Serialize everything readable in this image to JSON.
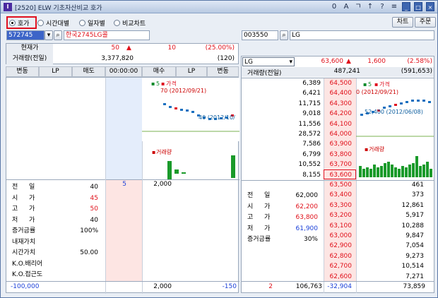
{
  "window": {
    "title": "[2520] ELW 기초자산비교 호가",
    "icon": "I",
    "buttons": [
      "0",
      "A",
      "ㄱ",
      "↑",
      "?",
      "≡",
      "_",
      "□",
      "×"
    ]
  },
  "tabs": {
    "hoga": "호가",
    "time": "시간대별",
    "daily": "일자별",
    "compare": "비교차트",
    "selected": "호가"
  },
  "toolbar": {
    "chart_btn": "차트",
    "order_btn": "주문"
  },
  "left": {
    "code": "572745",
    "name": "한국2745LG콜",
    "cur_price_label": "현재가",
    "cur_price": "50",
    "change_arrow": "▲",
    "change": "10",
    "change_pct": "(25.00%)",
    "vol_label": "거래량(전일)",
    "vol": "3,377,820",
    "vol_prev": "(120)",
    "headers": [
      "변동",
      "LP",
      "매도",
      "00:00:00",
      "매수",
      "LP",
      "변동"
    ],
    "buy_qty": "2,000",
    "buy_count": "5",
    "info": [
      [
        "전",
        "일",
        "40"
      ],
      [
        "시",
        "가",
        "45"
      ],
      [
        "고",
        "가",
        "50"
      ],
      [
        "저",
        "가",
        "40"
      ],
      [
        "증거금률",
        "",
        "100%"
      ],
      [
        "내재가치",
        "",
        ""
      ],
      [
        "시간가치",
        "",
        "50.00"
      ],
      [
        "K.O.배리어",
        "",
        ""
      ],
      [
        "K.O.접근도",
        "",
        ""
      ]
    ],
    "footer": {
      "left": "-100,000",
      "mid": "2,000",
      "right": "-150"
    },
    "chart": {
      "legend1": "5",
      "legend2": "가격",
      "price_label": "70 (2012/09/21)",
      "low_label": "40 (2012/10/",
      "vol_legend": "거래량"
    }
  },
  "right": {
    "code": "003550",
    "name": "LG",
    "select": "LG",
    "cur_price": "63,600",
    "change_arrow": "▲",
    "change": "1,600",
    "change_pct": "(2.58%)",
    "vol_label": "거래량(전일)",
    "vol": "487,241",
    "vol_prev": "(591,653)",
    "ask_qty": [
      "6,389",
      "6,421",
      "11,715",
      "9,018",
      "11,556",
      "28,572",
      "7,586",
      "6,799",
      "10,552",
      "8,155"
    ],
    "ask_price": [
      "64,500",
      "64,400",
      "64,300",
      "64,200",
      "64,100",
      "64,000",
      "63,900",
      "63,800",
      "63,700",
      "63,600"
    ],
    "bid_price": [
      "63,500",
      "63,400",
      "63,300",
      "63,200",
      "63,100",
      "63,000",
      "62,900",
      "62,800",
      "62,700",
      "62,600"
    ],
    "bid_qty": [
      "461",
      "373",
      "12,861",
      "5,917",
      "10,288",
      "9,847",
      "7,054",
      "9,273",
      "10,514",
      "7,271"
    ],
    "info": [
      [
        "전",
        "일",
        "62,000"
      ],
      [
        "시",
        "가",
        "62,200"
      ],
      [
        "고",
        "가",
        "63,800"
      ],
      [
        "저",
        "가",
        "61,900"
      ],
      [
        "증거금률",
        "",
        "30%"
      ]
    ],
    "footer": {
      "left": "2",
      "mid": "106,763",
      "diff": "-32,904",
      "right": "73,859"
    },
    "chart": {
      "legend1": "5",
      "legend2": "가격",
      "price_label": "0 (2012/09/21)",
      "low_label": "52,400 (2012/06/08)",
      "vol_legend": "거래량"
    }
  },
  "colors": {
    "up": "#e0101a",
    "down": "#1a3fd8",
    "accent": "#d81020"
  }
}
